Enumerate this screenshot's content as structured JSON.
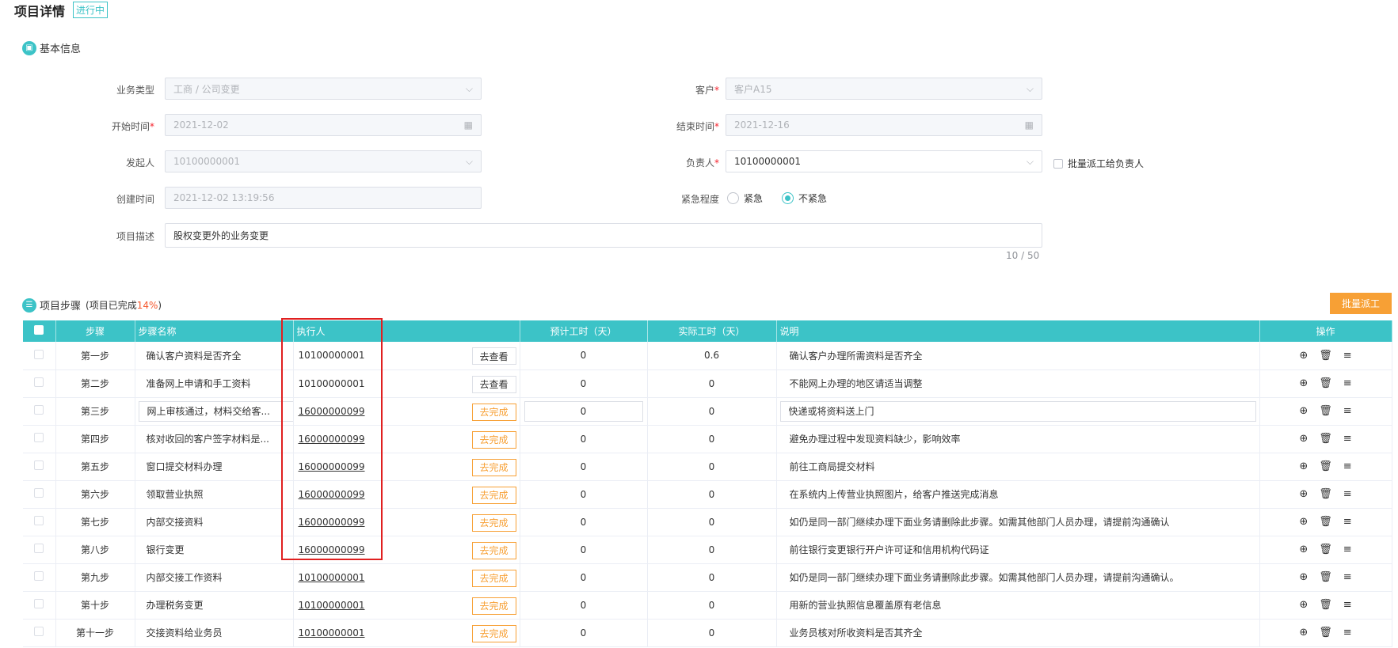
{
  "page": {
    "title": "项目详情",
    "status": "进行中"
  },
  "basic": {
    "heading": "基本信息",
    "icon": "image-icon",
    "business_type": {
      "label": "业务类型",
      "value": "工商 / 公司变更"
    },
    "customer": {
      "label": "客户",
      "value": "客户A15"
    },
    "start_time": {
      "label": "开始时间",
      "value": "2021-12-02"
    },
    "end_time": {
      "label": "结束时间",
      "value": "2021-12-16"
    },
    "initiator": {
      "label": "发起人",
      "value": "10100000001"
    },
    "owner": {
      "label": "负责人",
      "value": "10100000001"
    },
    "batch_assign_owner": "批量派工给负责人",
    "created": {
      "label": "创建时间",
      "value": "2021-12-02 13:19:56"
    },
    "urgency": {
      "label": "紧急程度",
      "opt_urgent": "紧急",
      "opt_normal": "不紧急",
      "selected": "不紧急"
    },
    "description": {
      "label": "项目描述",
      "value": "股权变更外的业务变更",
      "counter": "10 / 50"
    }
  },
  "steps": {
    "heading": "项目步骤",
    "progress_prefix": "(项目已完成",
    "progress_pct": "14%",
    "progress_suffix": ")",
    "batch_button": "批量派工",
    "accent": "#3cc3c7",
    "columns": [
      "步骤",
      "步骤名称",
      "执行人",
      "预计工时（天）",
      "实际工时（天）",
      "说明",
      "操作"
    ],
    "rows": [
      {
        "step": "第一步",
        "name": "确认客户资料是否齐全",
        "executor": "10100000001",
        "action": "去查看",
        "est": "0",
        "actual": "0.6",
        "desc": "确认客户办理所需资料是否齐全"
      },
      {
        "step": "第二步",
        "name": "准备网上申请和手工资料",
        "executor": "10100000001",
        "action": "去查看",
        "est": "0",
        "actual": "0",
        "desc": "不能网上办理的地区请适当调整"
      },
      {
        "step": "第三步",
        "name": "网上审核通过，材料交给客...",
        "executor": "16000000099",
        "action": "去完成",
        "est": "0",
        "actual": "0",
        "desc": "快递或将资料送上门"
      },
      {
        "step": "第四步",
        "name": "核对收回的客户签字材料是...",
        "executor": "16000000099",
        "action": "去完成",
        "est": "0",
        "actual": "0",
        "desc": "避免办理过程中发现资料缺少，影响效率"
      },
      {
        "step": "第五步",
        "name": "窗口提交材料办理",
        "executor": "16000000099",
        "action": "去完成",
        "est": "0",
        "actual": "0",
        "desc": "前往工商局提交材料"
      },
      {
        "step": "第六步",
        "name": "领取营业执照",
        "executor": "16000000099",
        "action": "去完成",
        "est": "0",
        "actual": "0",
        "desc": "在系统内上传营业执照图片，给客户推送完成消息"
      },
      {
        "step": "第七步",
        "name": "内部交接资料",
        "executor": "16000000099",
        "action": "去完成",
        "est": "0",
        "actual": "0",
        "desc": "如仍是同一部门继续办理下面业务请删除此步骤。如需其他部门人员办理，请提前沟通确认"
      },
      {
        "step": "第八步",
        "name": "银行变更",
        "executor": "16000000099",
        "action": "去完成",
        "est": "0",
        "actual": "0",
        "desc": "前往银行变更银行开户许可证和信用机构代码证"
      },
      {
        "step": "第九步",
        "name": "内部交接工作资料",
        "executor": "10100000001",
        "action": "去完成",
        "est": "0",
        "actual": "0",
        "desc": "如仍是同一部门继续办理下面业务请删除此步骤。如需其他部门人员办理，请提前沟通确认。"
      },
      {
        "step": "第十步",
        "name": "办理税务变更",
        "executor": "10100000001",
        "action": "去完成",
        "est": "0",
        "actual": "0",
        "desc": "用新的营业执照信息覆盖原有老信息"
      },
      {
        "step": "第十一步",
        "name": "交接资料给业务员",
        "executor": "10100000001",
        "action": "去完成",
        "est": "0",
        "actual": "0",
        "desc": "业务员核对所收资料是否其齐全"
      }
    ]
  }
}
